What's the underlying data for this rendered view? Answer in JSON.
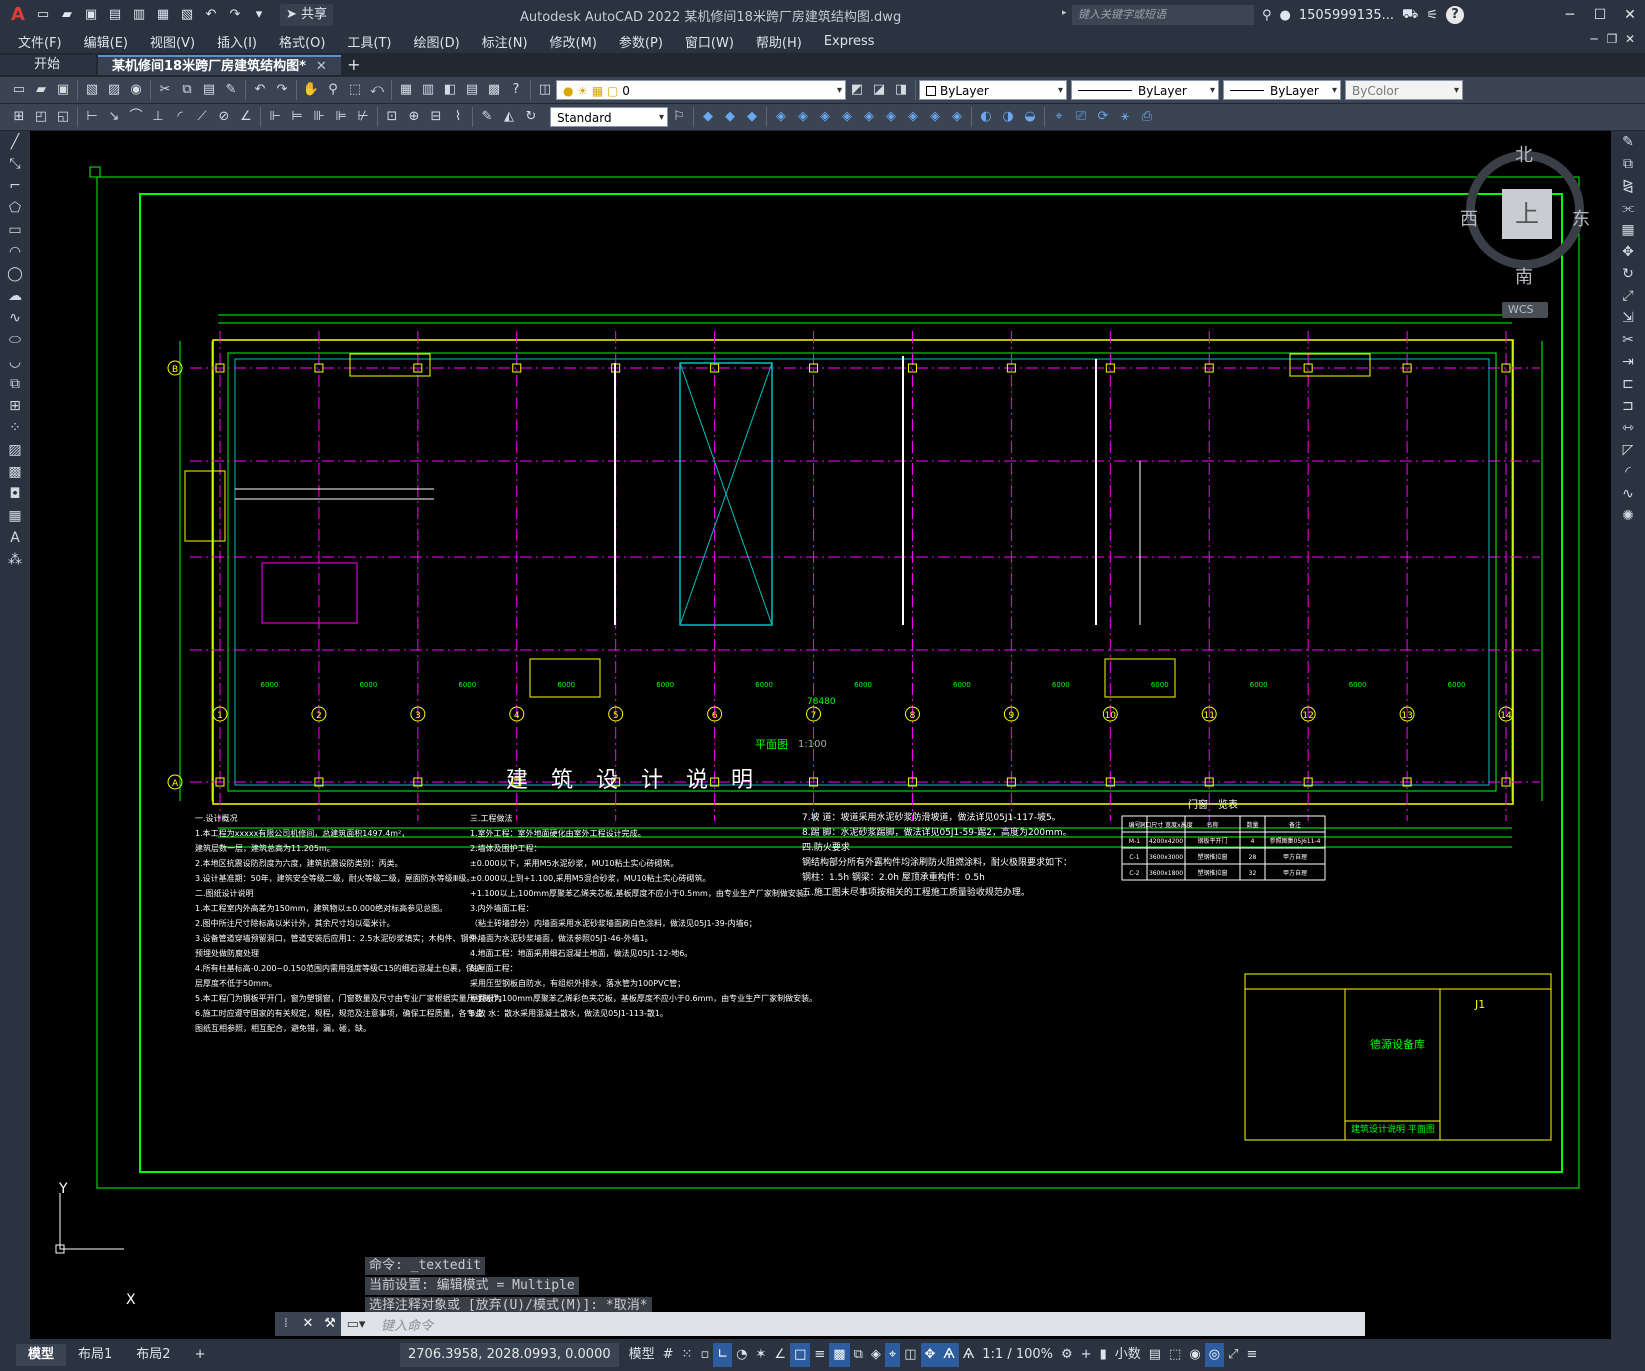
{
  "titlebar": {
    "app_logo": "A",
    "window_title": "Autodesk AutoCAD 2022    某机修间18米跨厂房建筑结构图.dwg",
    "share_label": "共享",
    "search_placeholder": "键入关键字或短语",
    "user_name": "1505999135...",
    "help": "?"
  },
  "menubar": {
    "items": [
      "文件(F)",
      "编辑(E)",
      "视图(V)",
      "插入(I)",
      "格式(O)",
      "工具(T)",
      "绘图(D)",
      "标注(N)",
      "修改(M)",
      "参数(P)",
      "窗口(W)",
      "帮助(H)",
      "Express"
    ]
  },
  "tabs": {
    "start": "开始",
    "active": "某机修间18米跨厂房建筑结构图*"
  },
  "toolbar": {
    "layer_value": "0",
    "color_value": "ByLayer",
    "linetype_value": "ByLayer",
    "lineweight_value": "ByLayer",
    "plotstyle_value": "ByColor",
    "textstyle_value": "Standard"
  },
  "viewcube": {
    "north": "北",
    "south": "南",
    "west": "西",
    "east": "东",
    "face": "上",
    "wcs": "WCS"
  },
  "drawing": {
    "plan_label": "平面图",
    "plan_scale": "1:100",
    "notes_title": "建 筑 设 计 说 明",
    "total_dim": "78480",
    "col_dims": [
      "6000",
      "6000",
      "6000",
      "6000",
      "6000",
      "6000",
      "6000",
      "6000",
      "6000",
      "6000",
      "6000",
      "6000",
      "6000"
    ],
    "axes_numbers": [
      "1",
      "2",
      "3",
      "4",
      "5",
      "6",
      "7",
      "8",
      "9",
      "10",
      "11",
      "12",
      "13",
      "14"
    ],
    "notes_col1": [
      "一.设计概况",
      "  1.本工程为xxxxx有限公司机修间，总建筑面积1497.4m²，",
      "     建筑层数一层，建筑总高为11.205m。",
      "  2.本地区抗震设防烈度为六度，建筑抗震设防类别：丙类。",
      "  3.设计基准期：50年，建筑安全等级二级，耐火等级二级，屋面防水等级Ⅲ级。",
      "二.图纸设计说明",
      "  1.本工程室内外高差为150mm，建筑物以±0.000绝对标高参见总图。",
      "  2.图中所注尺寸除标高以米计外，其余尺寸均以毫米计。",
      "  3.设备管道穿墙预留洞口，管道安装后应用1：2.5水泥砂浆填实；木构件、钢件，",
      "     预埋处做防腐处理",
      "  4.所有柱基标高-0.200~0.150范围内需用强度等级C15的细石混凝土包裹，保护",
      "     层厚度不低于50mm。",
      "  5.本工程门为钢板平开门，窗为塑钢窗，门窗数量及尺寸由专业厂家根据实量尺寸制作。",
      "  6.施工时应遵守国家的有关规定，规程，规范及注意事项，确保工程质量，各专业",
      "     图纸互相参照，相互配合，避免错，漏，碰，缺。"
    ],
    "notes_col2": [
      "三.工程做法",
      "  1.室外工程：室外地面硬化由室外工程设计完成。",
      "  2.墙体及围护工程：",
      "     ±0.000以下，采用M5水泥砂浆，MU10粘土实心砖砌筑。",
      "     ±0.000以上到+1.100,采用M5混合砂浆，MU10粘土实心砖砌筑。",
      "     +1.100以上,100mm厚聚苯乙烯夹芯板,基板厚度不应小于0.5mm，由专业生产厂家制做安装。",
      "  3.内外墙面工程：",
      "     （粘土砖墙部分）内墙面采用水泥砂浆墙面刷白色涂料，做法见05J1-39-内墙6；",
      "               外墙面为水泥砂浆墙面，做法参照05J1-46-外墙1。",
      "  4.地面工程：地面采用细石混凝土地面，做法见05J1-12-地6。",
      "  5.屋面工程：",
      "     采用压型钢板自防水，有组织外排水，落水管为100PVC管；",
      "     屋面板为100mm厚聚苯乙烯彩色夹芯板，基板厚度不应小于0.6mm，由专业生产厂家制做安装。",
      "  6.散  水：散水采用混凝土散水，做法见05J1-113-散1。"
    ],
    "notes_col3": [
      "7.坡  道：坡道采用水泥砂浆防滑坡道，做法详见05J1-117-坡5。",
      "8.踢  脚：水泥砂浆踢脚，做法详见05J1-59-踢2，高度为200mm。",
      "四.防火要求",
      "   钢结构部分所有外露构件均涂刷防火阻燃涂料，耐火极限要求如下：",
      "     钢柱：1.5h    钢梁：2.0h     屋顶承重构件：0.5h",
      "五.施工图未尽事项按相关的工程施工质量验收规范办理。"
    ],
    "door_table_title": "门窗一览表",
    "door_table_headers": [
      "编号",
      "洞口尺寸 宽度x高度",
      "名称",
      "数量",
      "备注"
    ],
    "door_table_rows": [
      [
        "M-1",
        "4200x4200",
        "钢板平开门",
        "4",
        "参照图集05J611-4"
      ],
      [
        "C-1",
        "3600x3000",
        "塑钢推拉窗",
        "28",
        "甲方自理"
      ],
      [
        "C-2",
        "3600x1800",
        "塑钢推拉窗",
        "32",
        "甲方自理"
      ]
    ],
    "titleblock_project": "德源设备库",
    "titleblock_drawing": "建筑设计说明  平面图",
    "titleblock_no": "J1",
    "ucs_x": "X",
    "ucs_y": "Y"
  },
  "command": {
    "history": [
      "命令: _textedit",
      "当前设置: 编辑模式 = Multiple",
      "选择注释对象或 [放弃(U)/模式(M)]: *取消*"
    ],
    "placeholder": "键入命令"
  },
  "layout_tabs": [
    "模型",
    "布局1",
    "布局2"
  ],
  "status": {
    "coords": "2706.3958, 2028.0993, 0.0000",
    "model": "模型",
    "scale": "1:1 / 100%",
    "units": "小数"
  },
  "colors": {
    "wall": "#ffff00",
    "axis": "#ff00ff",
    "dim": "#00ff00",
    "frame": "#00ff00",
    "column": "#ffff00",
    "opening": "#00c0c0",
    "text": "#ffffff"
  }
}
